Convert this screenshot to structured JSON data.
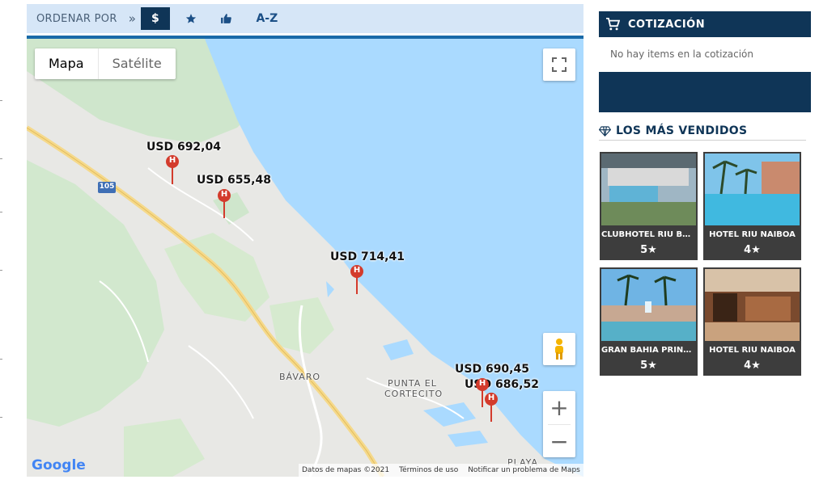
{
  "sort": {
    "label": "ORDENAR POR",
    "arrow": "»",
    "options": {
      "price": "$",
      "rating_icon": "star-icon",
      "popular_icon": "thumbs-up-icon",
      "az": "A-Z"
    }
  },
  "map": {
    "type_options": [
      "Mapa",
      "Satélite"
    ],
    "markers": [
      "USD 692,04",
      "USD 655,48",
      "USD 714,41",
      "USD 690,45",
      "USD 686,52"
    ],
    "marker_letter": "H",
    "places": [
      "BÁVARO",
      "PUNTA EL",
      "CORTECITO",
      "PLAYA"
    ],
    "highway": "105",
    "logo": "Google",
    "attribution": [
      "Datos de mapas ©2021",
      "Términos de uso",
      "Notificar un problema de Maps"
    ],
    "zoom_in": "+",
    "zoom_out": "−"
  },
  "quote": {
    "title": "COTIZACIÓN",
    "empty_text": "No hay items en la cotización"
  },
  "best_sellers": {
    "title": "LOS MÁS VENDIDOS",
    "items": [
      {
        "name": "CLUBHOTEL RIU BAMBU",
        "stars": "5★"
      },
      {
        "name": "HOTEL RIU NAIBOA",
        "stars": "4★"
      },
      {
        "name": "GRAN BAHIA PRINCIPE",
        "stars": "5★"
      },
      {
        "name": "HOTEL RIU NAIBOA",
        "stars": "4★"
      }
    ]
  },
  "colors": {
    "navy": "#0f3557",
    "water": "#aadaff",
    "marker": "#d33b2c",
    "sortbar": "#d6e6f7"
  }
}
